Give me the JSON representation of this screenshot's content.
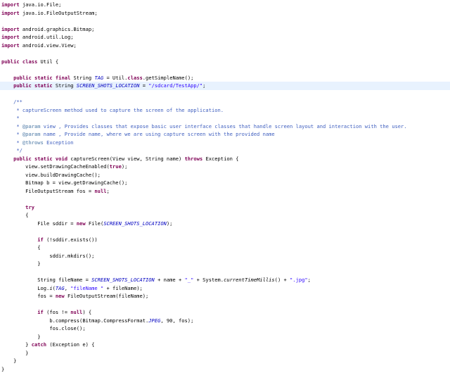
{
  "editor": {
    "lines": [
      {
        "tokens": [
          {
            "t": "import",
            "c": "kw"
          },
          {
            "t": " java.io.File;"
          }
        ]
      },
      {
        "tokens": [
          {
            "t": "import",
            "c": "kw"
          },
          {
            "t": " java.io.FileOutputStream;"
          }
        ]
      },
      {
        "blank": true
      },
      {
        "tokens": [
          {
            "t": "import",
            "c": "kw"
          },
          {
            "t": " android.graphics.Bitmap;"
          }
        ]
      },
      {
        "tokens": [
          {
            "t": "import",
            "c": "kw"
          },
          {
            "t": " android.util.Log;"
          }
        ]
      },
      {
        "tokens": [
          {
            "t": "import",
            "c": "kw"
          },
          {
            "t": " android.view.View;"
          }
        ]
      },
      {
        "blank": true
      },
      {
        "tokens": [
          {
            "t": "public",
            "c": "kw"
          },
          {
            "t": " "
          },
          {
            "t": "class",
            "c": "kw"
          },
          {
            "t": " Util {"
          }
        ]
      },
      {
        "blank": true
      },
      {
        "indent": "    ",
        "tokens": [
          {
            "t": "public",
            "c": "kw"
          },
          {
            "t": " "
          },
          {
            "t": "static",
            "c": "kw"
          },
          {
            "t": " "
          },
          {
            "t": "final",
            "c": "kw"
          },
          {
            "t": " String "
          },
          {
            "t": "TAG",
            "c": "fi"
          },
          {
            "t": " = Util."
          },
          {
            "t": "class",
            "c": "kw"
          },
          {
            "t": ".getSimpleName();"
          }
        ]
      },
      {
        "highlight": true,
        "indent": "    ",
        "tokens": [
          {
            "t": "public",
            "c": "kw"
          },
          {
            "t": " "
          },
          {
            "t": "static",
            "c": "kw"
          },
          {
            "t": " String "
          },
          {
            "t": "SCREEN_SHOTS_LOCATION",
            "c": "fi"
          },
          {
            "t": " = "
          },
          {
            "t": "\"/sdcard/TestApp/\"",
            "c": "st"
          },
          {
            "t": ";"
          }
        ]
      },
      {
        "blank": true
      },
      {
        "indent": "    ",
        "tokens": [
          {
            "t": "/**",
            "c": "cm"
          }
        ]
      },
      {
        "indent": "     ",
        "tokens": [
          {
            "t": "* captureScreen method used to capture the screen of the application.",
            "c": "cm"
          }
        ]
      },
      {
        "indent": "     ",
        "tokens": [
          {
            "t": "*",
            "c": "cm"
          }
        ]
      },
      {
        "indent": "     ",
        "tokens": [
          {
            "t": "* ",
            "c": "cm"
          },
          {
            "t": "@param",
            "c": "tg"
          },
          {
            "t": " view , Provides classes that expose basic user interface classes that handle screen layout and interaction with the user.",
            "c": "cm"
          }
        ]
      },
      {
        "indent": "     ",
        "tokens": [
          {
            "t": "* ",
            "c": "cm"
          },
          {
            "t": "@param",
            "c": "tg"
          },
          {
            "t": " name , Provide name, where we are using capture screen with the provided name",
            "c": "cm"
          }
        ]
      },
      {
        "indent": "     ",
        "tokens": [
          {
            "t": "* ",
            "c": "cm"
          },
          {
            "t": "@throws",
            "c": "tg"
          },
          {
            "t": " Exception",
            "c": "cm"
          }
        ]
      },
      {
        "indent": "     ",
        "tokens": [
          {
            "t": "*/",
            "c": "cm"
          }
        ]
      },
      {
        "indent": "    ",
        "tokens": [
          {
            "t": "public",
            "c": "kw"
          },
          {
            "t": " "
          },
          {
            "t": "static",
            "c": "kw"
          },
          {
            "t": " "
          },
          {
            "t": "void",
            "c": "kw"
          },
          {
            "t": " captureScreen(View view, String name) "
          },
          {
            "t": "throws",
            "c": "kw"
          },
          {
            "t": " Exception {"
          }
        ]
      },
      {
        "indent": "        ",
        "tokens": [
          {
            "t": "view.setDrawingCacheEnabled("
          },
          {
            "t": "true",
            "c": "kw"
          },
          {
            "t": ");"
          }
        ]
      },
      {
        "indent": "        ",
        "tokens": [
          {
            "t": "view.buildDrawingCache();"
          }
        ]
      },
      {
        "indent": "        ",
        "tokens": [
          {
            "t": "Bitmap b = view.getDrawingCache();"
          }
        ]
      },
      {
        "indent": "        ",
        "tokens": [
          {
            "t": "FileOutputStream fos = "
          },
          {
            "t": "null",
            "c": "kw"
          },
          {
            "t": ";"
          }
        ]
      },
      {
        "blank": true
      },
      {
        "indent": "        ",
        "tokens": [
          {
            "t": "try",
            "c": "kw"
          }
        ]
      },
      {
        "indent": "        ",
        "tokens": [
          {
            "t": "{"
          }
        ]
      },
      {
        "indent": "            ",
        "tokens": [
          {
            "t": "File sddir = "
          },
          {
            "t": "new",
            "c": "kw"
          },
          {
            "t": " File("
          },
          {
            "t": "SCREEN_SHOTS_LOCATION",
            "c": "fi"
          },
          {
            "t": ");"
          }
        ]
      },
      {
        "blank": true
      },
      {
        "indent": "            ",
        "tokens": [
          {
            "t": "if",
            "c": "kw"
          },
          {
            "t": " (!sddir.exists())"
          }
        ]
      },
      {
        "indent": "            ",
        "tokens": [
          {
            "t": "{"
          }
        ]
      },
      {
        "indent": "                ",
        "tokens": [
          {
            "t": "sddir.mkdirs();"
          }
        ]
      },
      {
        "indent": "            ",
        "tokens": [
          {
            "t": "}"
          }
        ]
      },
      {
        "blank": true
      },
      {
        "indent": "            ",
        "tokens": [
          {
            "t": "String fileName = "
          },
          {
            "t": "SCREEN_SHOTS_LOCATION",
            "c": "fi"
          },
          {
            "t": " + name + "
          },
          {
            "t": "\"_\"",
            "c": "st"
          },
          {
            "t": " + System."
          },
          {
            "t": "currentTimeMillis",
            "c": "it"
          },
          {
            "t": "() + "
          },
          {
            "t": "\".jpg\"",
            "c": "st"
          },
          {
            "t": ";"
          }
        ]
      },
      {
        "indent": "            ",
        "tokens": [
          {
            "t": "Log."
          },
          {
            "t": "i",
            "c": "it"
          },
          {
            "t": "("
          },
          {
            "t": "TAG",
            "c": "fi"
          },
          {
            "t": ", "
          },
          {
            "t": "\"fileName \"",
            "c": "st"
          },
          {
            "t": " + fileName);"
          }
        ]
      },
      {
        "indent": "            ",
        "tokens": [
          {
            "t": "fos = "
          },
          {
            "t": "new",
            "c": "kw"
          },
          {
            "t": " FileOutputStream(fileName);"
          }
        ]
      },
      {
        "blank": true
      },
      {
        "indent": "            ",
        "tokens": [
          {
            "t": "if",
            "c": "kw"
          },
          {
            "t": " (fos != "
          },
          {
            "t": "null",
            "c": "kw"
          },
          {
            "t": ") {"
          }
        ]
      },
      {
        "indent": "                ",
        "tokens": [
          {
            "t": "b.compress(Bitmap.CompressFormat."
          },
          {
            "t": "JPEG",
            "c": "fi"
          },
          {
            "t": ", 90, fos);"
          }
        ]
      },
      {
        "indent": "                ",
        "tokens": [
          {
            "t": "fos.close();"
          }
        ]
      },
      {
        "indent": "            ",
        "tokens": [
          {
            "t": "}"
          }
        ]
      },
      {
        "indent": "        ",
        "tokens": [
          {
            "t": "} "
          },
          {
            "t": "catch",
            "c": "kw"
          },
          {
            "t": " (Exception e) {"
          }
        ]
      },
      {
        "indent": "        ",
        "tokens": [
          {
            "t": "}"
          }
        ]
      },
      {
        "indent": "    ",
        "tokens": [
          {
            "t": "}"
          }
        ]
      },
      {
        "tokens": [
          {
            "t": "}"
          }
        ]
      }
    ]
  }
}
